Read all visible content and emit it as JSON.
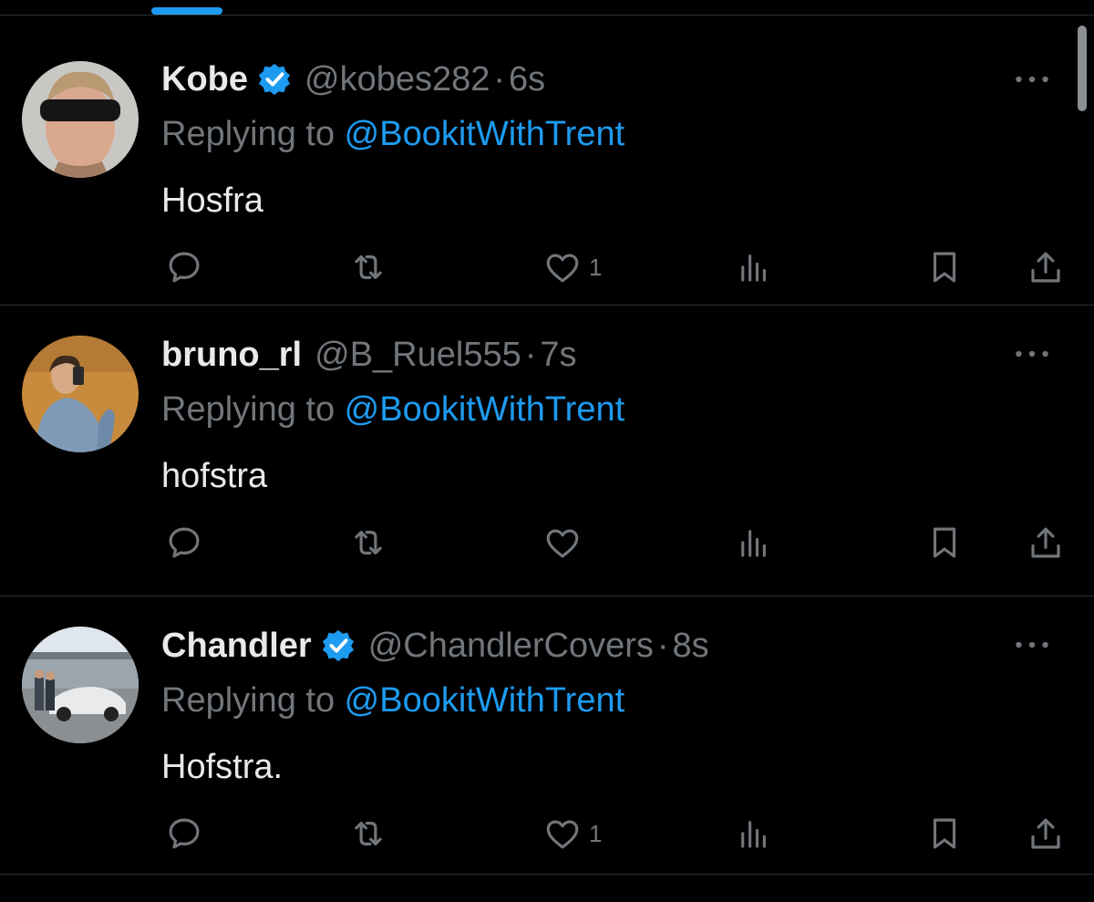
{
  "colors": {
    "background": "#000000",
    "accent": "#1d9bf0",
    "text_primary": "#e7e9ea",
    "text_secondary": "#71767b",
    "divider": "#2f3336"
  },
  "tweets": [
    {
      "name": "Kobe",
      "verified": true,
      "handle": "@kobes282",
      "separator": "·",
      "time": "6s",
      "replying_prefix": "Replying to ",
      "replying_to": "@BookitWithTrent",
      "text": "Hosfra",
      "likes": "1",
      "avatar": "avatar-kobe"
    },
    {
      "name": "bruno_rl",
      "verified": false,
      "handle": "@B_Ruel555",
      "separator": "·",
      "time": "7s",
      "replying_prefix": "Replying to ",
      "replying_to": "@BookitWithTrent",
      "text": "hofstra",
      "likes": "",
      "avatar": "avatar-bruno"
    },
    {
      "name": "Chandler",
      "verified": true,
      "handle": "@ChandlerCovers",
      "separator": "·",
      "time": "8s",
      "replying_prefix": "Replying to ",
      "replying_to": "@BookitWithTrent",
      "text": "Hofstra.",
      "likes": "1",
      "avatar": "avatar-chandler"
    }
  ],
  "icons": {
    "more": "more-horizontal-icon",
    "reply": "reply-icon",
    "retweet": "retweet-icon",
    "like": "heart-icon",
    "views": "views-icon",
    "bookmark": "bookmark-icon",
    "share": "share-icon",
    "verified": "verified-badge-icon"
  }
}
